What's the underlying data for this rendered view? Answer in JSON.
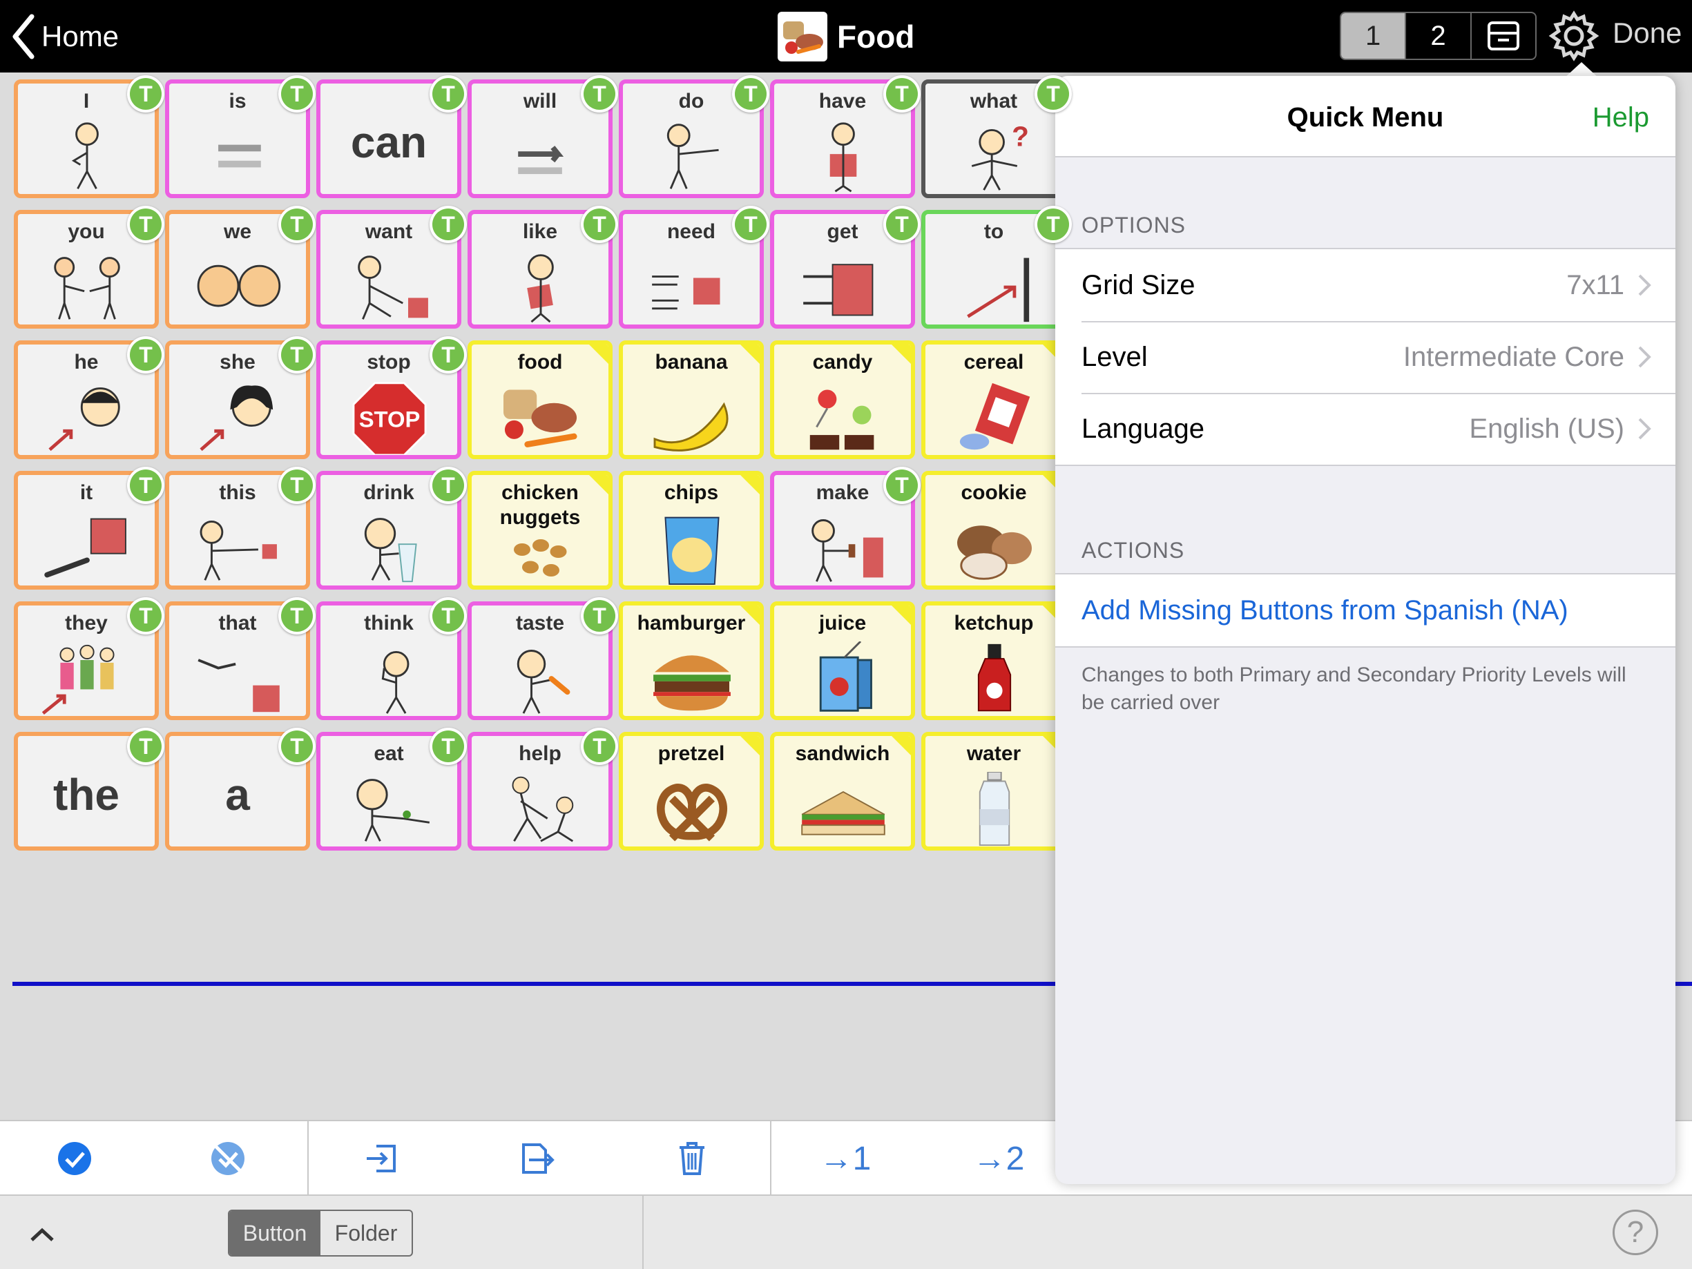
{
  "topbar": {
    "back_label": "Home",
    "title": "Food",
    "pages": [
      "1",
      "2"
    ],
    "selected_page": "1",
    "done_label": "Done"
  },
  "grid": {
    "cells": [
      {
        "label": "I",
        "color": "orange",
        "t": true,
        "pic": "person-pointing-self"
      },
      {
        "label": "is",
        "color": "pink",
        "t": true,
        "pic": "equals"
      },
      {
        "label": "",
        "big": "can",
        "color": "pink",
        "t": true
      },
      {
        "label": "will",
        "color": "pink",
        "t": true,
        "pic": "arrow-right"
      },
      {
        "label": "do",
        "color": "pink",
        "t": true,
        "pic": "person-reaching"
      },
      {
        "label": "have",
        "color": "pink",
        "t": true,
        "pic": "person-holding-box"
      },
      {
        "label": "what",
        "color": "gray",
        "t": true,
        "pic": "person-question"
      },
      {
        "label": "you",
        "color": "orange",
        "t": true,
        "pic": "two-people"
      },
      {
        "label": "we",
        "color": "orange",
        "t": true,
        "pic": "two-faces"
      },
      {
        "label": "want",
        "color": "pink",
        "t": true,
        "pic": "person-reaching-box"
      },
      {
        "label": "like",
        "color": "pink",
        "t": true,
        "pic": "person-hugging"
      },
      {
        "label": "need",
        "color": "pink",
        "t": true,
        "pic": "hands-box"
      },
      {
        "label": "get",
        "color": "pink",
        "t": true,
        "pic": "grab-box"
      },
      {
        "label": "to",
        "color": "green",
        "t": true,
        "pic": "arrow-to-line"
      },
      {
        "label": "he",
        "color": "orange",
        "t": true,
        "pic": "boy-face"
      },
      {
        "label": "she",
        "color": "orange",
        "t": true,
        "pic": "girl-face"
      },
      {
        "label": "stop",
        "color": "pink",
        "t": true,
        "pic": "stop-sign"
      },
      {
        "label": "food",
        "color": "yellow",
        "folder": true,
        "pic": "food-pile"
      },
      {
        "label": "banana",
        "color": "yellow",
        "folder": true,
        "pic": "banana"
      },
      {
        "label": "candy",
        "color": "yellow",
        "folder": true,
        "pic": "candy"
      },
      {
        "label": "cereal",
        "color": "yellow",
        "folder": true,
        "pic": "cereal"
      },
      {
        "label": "it",
        "color": "orange",
        "t": true,
        "pic": "hand-point-box"
      },
      {
        "label": "this",
        "color": "orange",
        "t": true,
        "pic": "person-point-box"
      },
      {
        "label": "drink",
        "color": "pink",
        "t": true,
        "pic": "person-drink"
      },
      {
        "label": "chicken nuggets",
        "color": "yellow",
        "folder": true,
        "pic": "nuggets"
      },
      {
        "label": "chips",
        "color": "yellow",
        "folder": true,
        "pic": "chips"
      },
      {
        "label": "make",
        "color": "pink",
        "t": true,
        "pic": "person-hammer"
      },
      {
        "label": "cookie",
        "color": "yellow",
        "folder": true,
        "pic": "cookies"
      },
      {
        "label": "they",
        "color": "orange",
        "t": true,
        "pic": "group-people"
      },
      {
        "label": "that",
        "color": "orange",
        "t": true,
        "pic": "hand-point-far-box"
      },
      {
        "label": "think",
        "color": "pink",
        "t": true,
        "pic": "person-think"
      },
      {
        "label": "taste",
        "color": "pink",
        "t": true,
        "pic": "person-taste"
      },
      {
        "label": "hamburger",
        "color": "yellow",
        "folder": true,
        "pic": "hamburger"
      },
      {
        "label": "juice",
        "color": "yellow",
        "folder": true,
        "pic": "juice-box"
      },
      {
        "label": "ketchup",
        "color": "yellow",
        "folder": true,
        "pic": "ketchup"
      },
      {
        "label": "",
        "big": "the",
        "color": "orange",
        "t": true
      },
      {
        "label": "",
        "big": "a",
        "color": "orange",
        "t": true
      },
      {
        "label": "eat",
        "color": "pink",
        "t": true,
        "pic": "person-eat"
      },
      {
        "label": "help",
        "color": "pink",
        "t": true,
        "pic": "person-help"
      },
      {
        "label": "pretzel",
        "color": "yellow",
        "folder": true,
        "pic": "pretzel"
      },
      {
        "label": "sandwich",
        "color": "yellow",
        "folder": true,
        "pic": "sandwich"
      },
      {
        "label": "water",
        "color": "yellow",
        "folder": true,
        "pic": "water-bottle"
      }
    ],
    "badge_letter": "T"
  },
  "toolbar": {
    "tools": [
      "select-all-icon",
      "deselect-icon",
      "import-icon",
      "export-icon",
      "trash-icon",
      "move-to-page-1",
      "move-to-page-2"
    ],
    "move1_label": "→1",
    "move2_label": "→2"
  },
  "bottombar": {
    "segment": [
      "Button",
      "Folder"
    ],
    "selected": "Button",
    "help_label": "?"
  },
  "quick_menu": {
    "title": "Quick Menu",
    "help_label": "Help",
    "options_header": "OPTIONS",
    "options": [
      {
        "label": "Grid Size",
        "value": "7x11"
      },
      {
        "label": "Level",
        "value": "Intermediate Core"
      },
      {
        "label": "Language",
        "value": "English (US)"
      }
    ],
    "actions_header": "ACTIONS",
    "action_label": "Add Missing Buttons from Spanish (NA)",
    "footnote": "Changes to both Primary and Secondary Priority Levels will be carried over"
  },
  "colors": {
    "orange": "#f7a35b",
    "pink": "#ec5fe2",
    "yellow": "#f5ee2c",
    "green": "#6ad65a",
    "gray": "#555555",
    "badge_green": "#74c04b",
    "link_blue": "#1a66d8",
    "help_green": "#1b9a31"
  }
}
